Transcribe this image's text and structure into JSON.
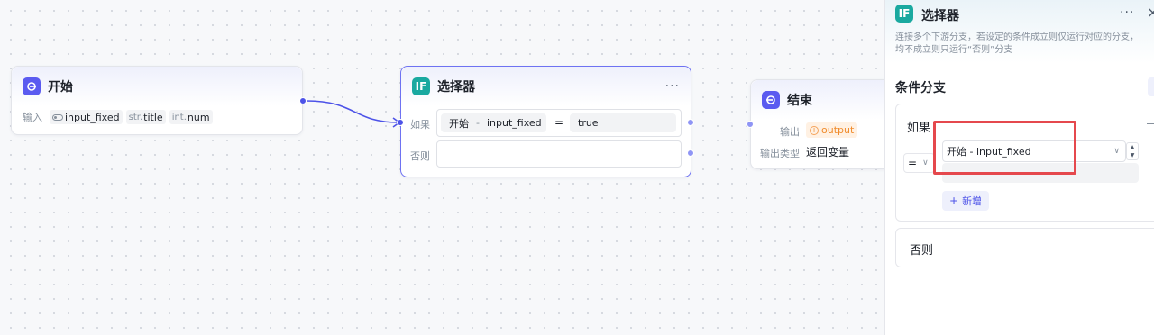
{
  "start_node": {
    "title": "开始",
    "input_label": "输入",
    "params": [
      {
        "prefix": "",
        "name": "input_fixed"
      },
      {
        "prefix": "str.",
        "name": "title"
      },
      {
        "prefix": "int.",
        "name": "num"
      }
    ]
  },
  "selector_node": {
    "icon": "IF",
    "title": "选择器",
    "more": "···",
    "if_label": "如果",
    "else_label": "否则",
    "condition": {
      "left_source": "开始",
      "sep": "-",
      "left_var": "input_fixed",
      "operator": "=",
      "right_value": "true"
    }
  },
  "end_node": {
    "title": "结束",
    "output_label": "输出",
    "output_tag": "output",
    "output_type_label": "输出类型",
    "output_type_value": "返回变量"
  },
  "panel": {
    "icon": "IF",
    "title": "选择器",
    "more": "···",
    "close": "×",
    "desc_line1": "连接多个下游分支，若设定的条件成立则仅运行对应的分支，",
    "desc_line2": "均不成立则只运行“否则”分支",
    "section_title": "条件分支",
    "if_label": "如果",
    "operator": "=",
    "var_select": "开始 - input_fixed",
    "add_label": "新增",
    "else_label": "否则"
  },
  "colors": {
    "accent": "#4d53e8",
    "highlight_box": "#e5484d",
    "output_tag": "#f5a35a"
  }
}
